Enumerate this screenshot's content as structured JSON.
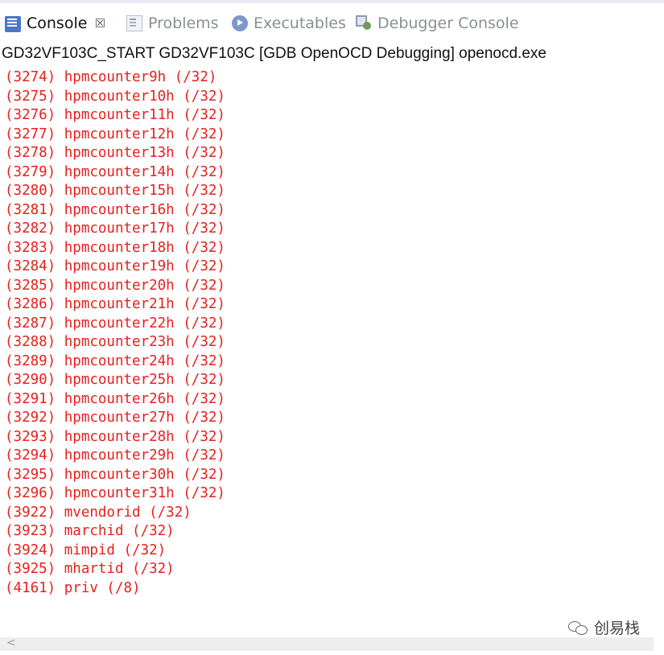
{
  "tabs": [
    {
      "label": "Console",
      "icon": "console-icon",
      "active": true,
      "close_glyph": "☒"
    },
    {
      "label": "Problems",
      "icon": "problems-icon",
      "active": false
    },
    {
      "label": "Executables",
      "icon": "executables-icon",
      "active": false
    },
    {
      "label": "Debugger Console",
      "icon": "debugger-console-icon",
      "active": false
    }
  ],
  "session_title": "GD32VF103C_START GD32VF103C [GDB OpenOCD Debugging] openocd.exe",
  "console_color": "#e8201e",
  "lines": [
    "(3274) hpmcounter9h (/32)",
    "(3275) hpmcounter10h (/32)",
    "(3276) hpmcounter11h (/32)",
    "(3277) hpmcounter12h (/32)",
    "(3278) hpmcounter13h (/32)",
    "(3279) hpmcounter14h (/32)",
    "(3280) hpmcounter15h (/32)",
    "(3281) hpmcounter16h (/32)",
    "(3282) hpmcounter17h (/32)",
    "(3283) hpmcounter18h (/32)",
    "(3284) hpmcounter19h (/32)",
    "(3285) hpmcounter20h (/32)",
    "(3286) hpmcounter21h (/32)",
    "(3287) hpmcounter22h (/32)",
    "(3288) hpmcounter23h (/32)",
    "(3289) hpmcounter24h (/32)",
    "(3290) hpmcounter25h (/32)",
    "(3291) hpmcounter26h (/32)",
    "(3292) hpmcounter27h (/32)",
    "(3293) hpmcounter28h (/32)",
    "(3294) hpmcounter29h (/32)",
    "(3295) hpmcounter30h (/32)",
    "(3296) hpmcounter31h (/32)",
    "(3922) mvendorid (/32)",
    "(3923) marchid (/32)",
    "(3924) mimpid (/32)",
    "(3925) mhartid (/32)",
    "(4161) priv (/8)"
  ],
  "watermark": {
    "text": "创易栈",
    "icon": "wechat-icon"
  },
  "scrollbar": {
    "left_arrow": "<"
  }
}
